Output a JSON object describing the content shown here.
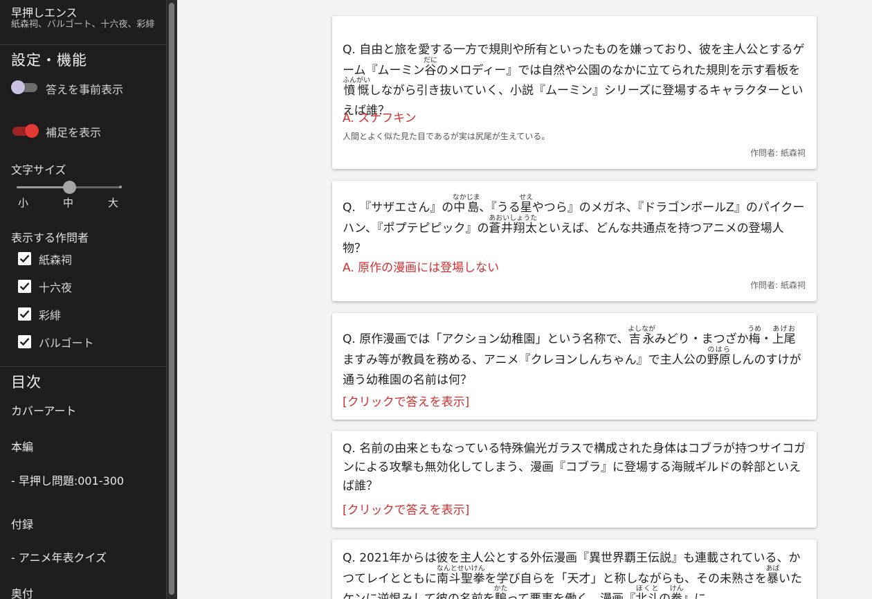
{
  "sidebar": {
    "title": "早押しエンス",
    "subtitle": "紙森祠、バルゴート、十六夜、彩緋",
    "settings_title": "設定・機能",
    "toggle_show_answers": {
      "label": "答えを事前表示",
      "on": false
    },
    "toggle_show_notes": {
      "label": "補足を表示",
      "on": true
    },
    "font_size": {
      "label": "文字サイズ",
      "ticks": [
        "小",
        "中",
        "大"
      ],
      "value_fraction": 0.5
    },
    "authors_title": "表示する作問者",
    "authors": [
      {
        "name": "紙森祠",
        "checked": true
      },
      {
        "name": "十六夜",
        "checked": true
      },
      {
        "name": "彩緋",
        "checked": true
      },
      {
        "name": "バルゴート",
        "checked": true
      }
    ],
    "toc_title": "目次",
    "toc": [
      "カバーアート",
      "本編",
      "- 早押し問題:001-300",
      "付録",
      "- アニメ年表クイズ",
      "奥付"
    ]
  },
  "cards": [
    {
      "q_prefix": "Q. ",
      "q_part1": "自由と旅を愛する一方で規則や所有といったものを嫌っており、彼を主人公とするゲーム『ムーミン",
      "q_ruby1_base": "谷",
      "q_ruby1_rt": "だに",
      "q_part2": "のメロディー』では自然や公園のなかに立てられた規則を示す看板を",
      "q_ruby2_base": "憤慨",
      "q_ruby2_rt": "ふんがい",
      "q_part3": "しながら引き抜いていく、小説『ムーミン』シリーズに登場するキャラクターといえば誰？",
      "answer": "A. スナフキン",
      "note": "人間とよく似た見た目であるが実は尻尾が生えている。",
      "author": "作問者: 紙森祠"
    },
    {
      "q_prefix": "Q. ",
      "q_part1": "『サザエさん』の",
      "q_ruby1_base": "中島",
      "q_ruby1_rt": "なかじま",
      "q_part2": "、『うる",
      "q_ruby2_base": "星",
      "q_ruby2_rt": "せえ",
      "q_part3": "やつら』のメガネ、『ドラゴンボールZ』のパイクーハン、『ポプテピピック』の",
      "q_ruby3_base": "蒼井翔太",
      "q_ruby3_rt": "あおいしょうた",
      "q_part4": "といえば、どんな共通点を持つアニメの登場人物？",
      "answer": "A. 原作の漫画には登場しない",
      "author": "作問者: 紙森祠"
    },
    {
      "q_prefix": "Q. ",
      "q_part1": "原作漫画では「アクション幼稚園」という名称で、",
      "q_ruby1_base": "吉永",
      "q_ruby1_rt": "よしなが",
      "q_part2": "みどり・まつざか",
      "q_ruby2_base": "梅",
      "q_ruby2_rt": "うめ",
      "q_part3": "・",
      "q_ruby3_base": "上尾",
      "q_ruby3_rt": "あげお",
      "q_part4": "ますみ等が教員を務める、アニメ『クレヨンしんちゃん』で主人公の",
      "q_ruby4_base": "野原",
      "q_ruby4_rt": "のはら",
      "q_part5": "しんのすけが通う幼稚園の名前は何？",
      "reveal": "[クリックで答えを表示]"
    },
    {
      "q_prefix": "Q. ",
      "q_part1": "名前の由来ともなっている特殊偏光ガラスで構成された身体はコブラが持つサイコガンによる攻撃も無効化してしまう、漫画『コブラ』に登場する海賊ギルドの幹部といえば誰？",
      "reveal": "[クリックで答えを表示]"
    },
    {
      "q_prefix": "Q. ",
      "q_part1": "2021年からは彼を主人公とする外伝漫画『異世界覇王伝説』も連載されている、かつてレイとともに",
      "q_ruby1_base": "南斗聖拳",
      "q_ruby1_rt": "なんとせいけん",
      "q_part2": "を学び自らを「天才」と称しながらも、その未熟さを",
      "q_ruby2_base": "暴",
      "q_ruby2_rt": "あば",
      "q_part3": "いたケンに逆恨みして彼の名前を",
      "q_ruby3_base": "騙",
      "q_ruby3_rt": "かた",
      "q_part4": "って悪事を働く、漫画『",
      "q_ruby4_base": "北斗",
      "q_ruby4_rt": "ほくと",
      "q_part5": "の",
      "q_ruby5_base": "拳",
      "q_ruby5_rt": "けん",
      "q_part6": "』に"
    }
  ]
}
